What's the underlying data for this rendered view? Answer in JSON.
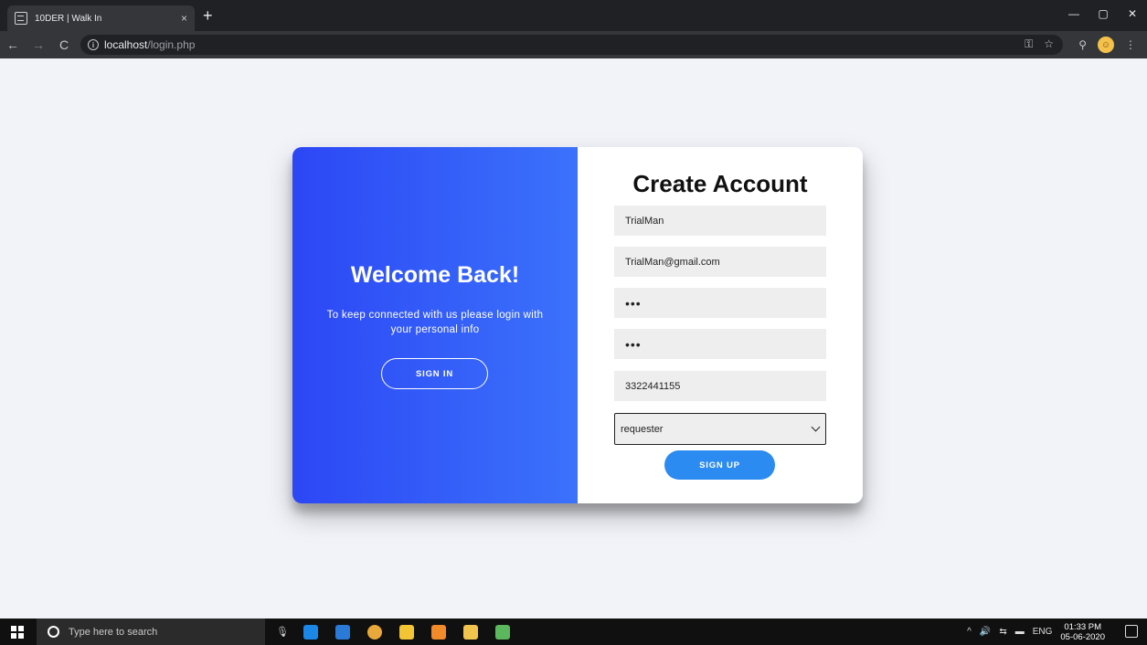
{
  "browser": {
    "tab_title": "10DER | Walk In",
    "tab_close": "×",
    "new_tab": "+",
    "url_host": "localhost",
    "url_path": "/login.php",
    "back": "←",
    "forward": "→",
    "reload": "C",
    "minimize": "—",
    "maximize": "▢",
    "close": "✕",
    "key_icon": "key-icon",
    "star": "☆",
    "menu": "⋮"
  },
  "overlay": {
    "title": "Welcome Back!",
    "text": "To keep connected with us please login with your personal info",
    "button_label": "SIGN IN"
  },
  "form": {
    "title": "Create Account",
    "name_value": "TrialMan",
    "email_value": "TrialMan@gmail.com",
    "password_value": "•••",
    "confirm_value": "•••",
    "phone_value": "3322441155",
    "role_selected": "requester",
    "submit_label": "SIGN UP"
  },
  "taskbar": {
    "search_placeholder": "Type here to search",
    "mic": "🎙",
    "tray_arrow": "^",
    "volume": "🔊",
    "lang": "ENG",
    "time": "01:33 PM",
    "date": "05-06-2020"
  },
  "colors": {
    "overlay_start": "#2c47f5",
    "overlay_end": "#3b72fb",
    "primary": "#2c8bf0"
  }
}
